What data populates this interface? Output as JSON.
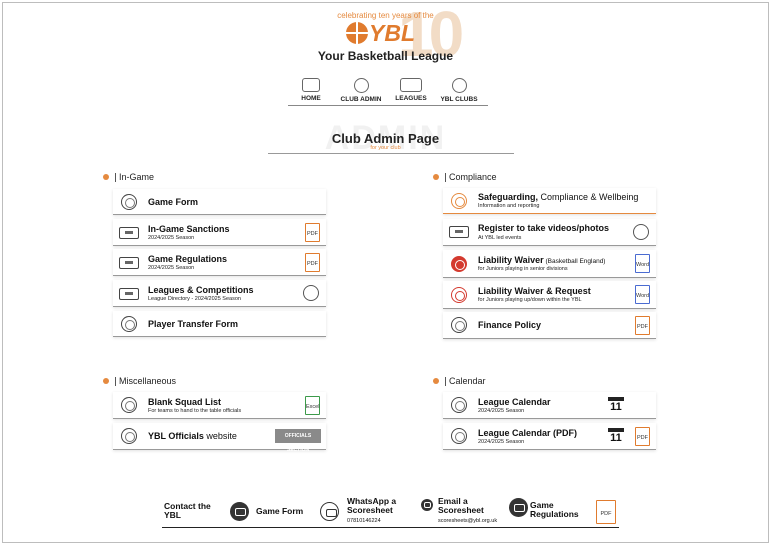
{
  "header": {
    "celebrating": "celebrating ten years of the",
    "big_number": "10",
    "logo_text": "YBL",
    "brand_name": "Your Basketball League"
  },
  "nav": {
    "items": [
      {
        "label": "HOME",
        "icon": "home-icon"
      },
      {
        "label": "CLUB ADMIN",
        "icon": "user-icon"
      },
      {
        "label": "LEAGUES",
        "icon": "court-icon"
      },
      {
        "label": "YBL CLUBS",
        "icon": "basketball-icon"
      }
    ]
  },
  "page": {
    "ghost_text": "ADMIN",
    "title": "Club Admin Page",
    "subtitle": "for your club"
  },
  "sections": {
    "ingame": {
      "heading": "In-Game",
      "items": [
        {
          "title": "Game Form"
        },
        {
          "title": "In-Game Sanctions",
          "sub": "2024/2025 Season",
          "badge": "PDF"
        },
        {
          "title": "Game Regulations",
          "sub": "2024/2025 Season",
          "badge": "PDF"
        },
        {
          "title": "Leagues & Competitions",
          "sub": "League Directory - 2024/2025 Season"
        },
        {
          "title": "Player Transfer Form"
        }
      ]
    },
    "compliance": {
      "heading": "Compliance",
      "items": [
        {
          "title_bold": "Safeguarding,",
          "title_rest": " Compliance & Wellbeing",
          "sub": "Information and reporting"
        },
        {
          "title": "Register to take videos/photos",
          "sub": "At YBL led events"
        },
        {
          "title_bold": "Liability Waiver",
          "title_small": " (Basketball England)",
          "sub": "for Juniors playing in senior divisions",
          "badge": "Word"
        },
        {
          "title": "Liability Waiver & Request",
          "sub": "for Juniors playing up/down within the YBL",
          "badge": "Word"
        },
        {
          "title": "Finance Policy",
          "badge": "PDF"
        }
      ]
    },
    "misc": {
      "heading": "Miscellaneous",
      "items": [
        {
          "title": "Blank Squad List",
          "sub": "For teams to hand to the table officials",
          "badge": "Excel"
        },
        {
          "title_bold": "YBL Officials",
          "title_rest": " website",
          "logo_text": "OFFICIALS SECTION"
        }
      ]
    },
    "calendar": {
      "heading": "Calendar",
      "items": [
        {
          "title": "League Calendar",
          "sub": "2024/2025 Season",
          "cal_day": "11"
        },
        {
          "title": "League Calendar (PDF)",
          "sub": "2024/2025 Season",
          "cal_day": "11",
          "badge": "PDF"
        }
      ]
    }
  },
  "footer": {
    "contact": "Contact the YBL",
    "game_form": "Game Form",
    "whatsapp": "WhatsApp a Scoresheet",
    "whatsapp_number": "07810146224",
    "email": "Email a Scoresheet",
    "email_address": "scoresheets@ybl.org.uk",
    "regs": "Game Regulations",
    "badge": "PDF"
  },
  "colors": {
    "accent": "#e58a3f",
    "brand": "#e07b2e",
    "text": "#111111"
  }
}
